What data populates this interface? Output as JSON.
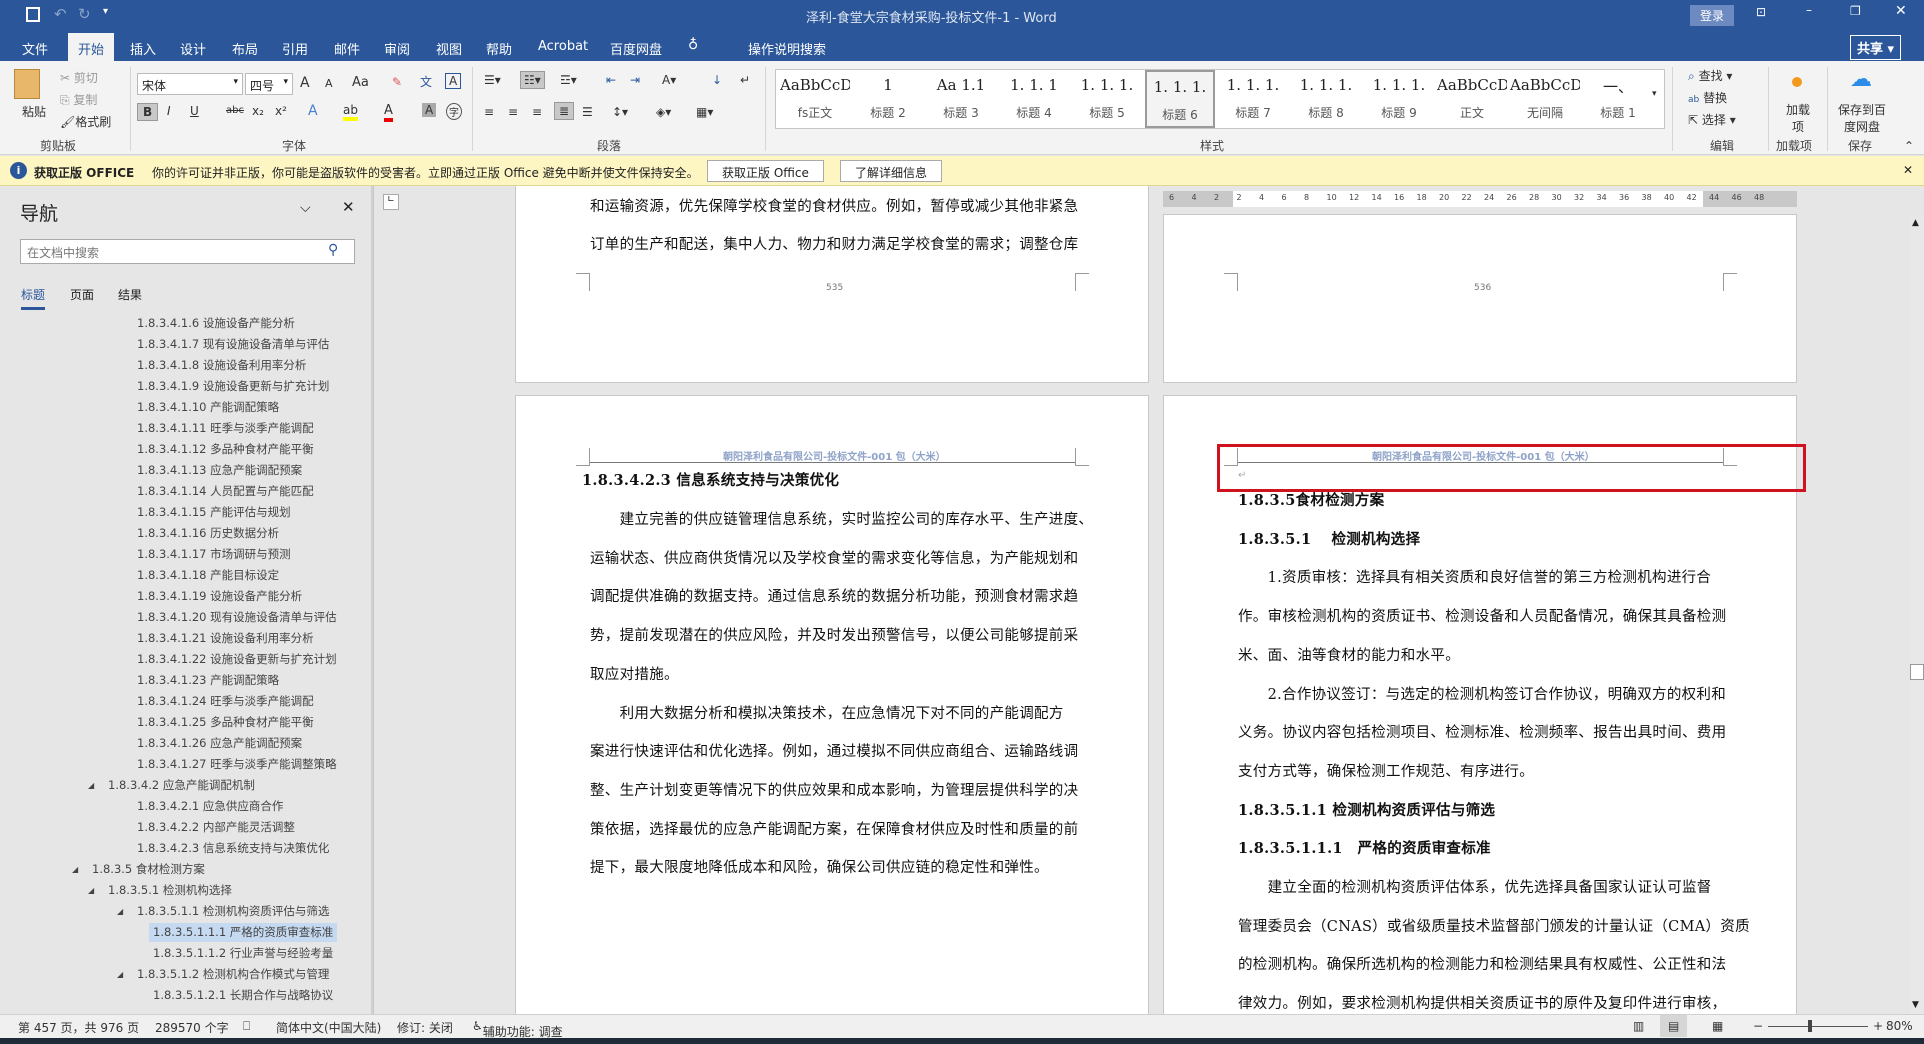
{
  "window": {
    "title": "泽利-食堂大宗食材采购-投标文件-1  -  Word",
    "login": "登录",
    "share": "共享"
  },
  "tabs": [
    "文件",
    "开始",
    "插入",
    "设计",
    "布局",
    "引用",
    "邮件",
    "审阅",
    "视图",
    "帮助",
    "Acrobat",
    "百度网盘"
  ],
  "tell_me": "操作说明搜索",
  "ribbon": {
    "clipboard": {
      "paste": "粘贴",
      "cut": "剪切",
      "copy": "复制",
      "format_painter": "格式刷",
      "label": "剪贴板"
    },
    "font": {
      "name": "宋体",
      "size": "四号",
      "bold": "B",
      "italic": "I",
      "underline": "U",
      "strike": "abc",
      "sub": "x₂",
      "sup": "x²",
      "label": "字体",
      "grow": "A",
      "shrink": "A",
      "case": "Aa"
    },
    "paragraph": {
      "label": "段落"
    },
    "styles": {
      "label": "样式",
      "items": [
        {
          "preview": "AaBbCcDdI",
          "name": "fs正文"
        },
        {
          "preview": "1",
          "name": "标题 2"
        },
        {
          "preview": "Aa 1.1",
          "name": "标题 3"
        },
        {
          "preview": "1. 1. 1",
          "name": "标题 4"
        },
        {
          "preview": "1. 1. 1.",
          "name": "标题 5"
        },
        {
          "preview": "1. 1. 1.",
          "name": "标题 6"
        },
        {
          "preview": "1. 1. 1.",
          "name": "标题 7"
        },
        {
          "preview": "1. 1. 1.",
          "name": "标题 8"
        },
        {
          "preview": "1. 1. 1.",
          "name": "标题 9"
        },
        {
          "preview": "AaBbCcDdI",
          "name": "正文"
        },
        {
          "preview": "AaBbCcDdI",
          "name": "无间隔"
        },
        {
          "preview": "一、",
          "name": "标题 1"
        }
      ]
    },
    "editing": {
      "find": "查找",
      "replace": "替换",
      "select": "选择",
      "label": "编辑"
    },
    "addins": {
      "button": "加载项",
      "label": "加载项"
    },
    "save": {
      "button": "保存到百度网盘",
      "label": "保存"
    }
  },
  "message_bar": {
    "title": "获取正版 OFFICE",
    "text": "你的许可证并非正版，你可能是盗版软件的受害者。立即通过正版 Office 避免中断并使文件保持安全。",
    "btn1": "获取正版 Office",
    "btn2": "了解详细信息"
  },
  "nav": {
    "title": "导航",
    "search_placeholder": "在文档中搜索",
    "tabs": [
      "标题",
      "页面",
      "结果"
    ],
    "items": [
      {
        "t": "1.8.3.4.1.6 设施设备产能分析",
        "l": 3
      },
      {
        "t": "1.8.3.4.1.7 现有设施设备清单与评估",
        "l": 3
      },
      {
        "t": "1.8.3.4.1.8 设施设备利用率分析",
        "l": 3
      },
      {
        "t": "1.8.3.4.1.9 设施设备更新与扩充计划",
        "l": 3
      },
      {
        "t": "1.8.3.4.1.10 产能调配策略",
        "l": 3
      },
      {
        "t": "1.8.3.4.1.11 旺季与淡季产能调配",
        "l": 3
      },
      {
        "t": "1.8.3.4.1.12 多品种食材产能平衡",
        "l": 3
      },
      {
        "t": "1.8.3.4.1.13 应急产能调配预案",
        "l": 3
      },
      {
        "t": "1.8.3.4.1.14 人员配置与产能匹配",
        "l": 3
      },
      {
        "t": "1.8.3.4.1.15 产能评估与规划",
        "l": 3
      },
      {
        "t": "1.8.3.4.1.16 历史数据分析",
        "l": 3
      },
      {
        "t": "1.8.3.4.1.17 市场调研与预测",
        "l": 3
      },
      {
        "t": "1.8.3.4.1.18 产能目标设定",
        "l": 3
      },
      {
        "t": "1.8.3.4.1.19 设施设备产能分析",
        "l": 3
      },
      {
        "t": "1.8.3.4.1.20 现有设施设备清单与评估",
        "l": 3
      },
      {
        "t": "1.8.3.4.1.21 设施设备利用率分析",
        "l": 3
      },
      {
        "t": "1.8.3.4.1.22 设施设备更新与扩充计划",
        "l": 3
      },
      {
        "t": "1.8.3.4.1.23 产能调配策略",
        "l": 3
      },
      {
        "t": "1.8.3.4.1.24 旺季与淡季产能调配",
        "l": 3
      },
      {
        "t": "1.8.3.4.1.25 多品种食材产能平衡",
        "l": 3
      },
      {
        "t": "1.8.3.4.1.26 应急产能调配预案",
        "l": 3
      },
      {
        "t": "1.8.3.4.1.27 旺季与淡季产能调整策略",
        "l": 3
      },
      {
        "t": "1.8.3.4.2 应急产能调配机制",
        "l": 2,
        "e": true
      },
      {
        "t": "1.8.3.4.2.1 应急供应商合作",
        "l": 3
      },
      {
        "t": "1.8.3.4.2.2 内部产能灵活调整",
        "l": 3
      },
      {
        "t": "1.8.3.4.2.3 信息系统支持与决策优化",
        "l": 3
      },
      {
        "t": "1.8.3.5 食材检测方案",
        "l": 1,
        "e": true
      },
      {
        "t": "1.8.3.5.1 检测机构选择",
        "l": 2,
        "e": true
      },
      {
        "t": "1.8.3.5.1.1 检测机构资质评估与筛选",
        "l": 3,
        "e": true
      },
      {
        "t": "1.8.3.5.1.1.1 严格的资质审查标准",
        "l": 4,
        "sel": true
      },
      {
        "t": "1.8.3.5.1.1.2 行业声誉与经验考量",
        "l": 4
      },
      {
        "t": "1.8.3.5.1.2 检测机构合作模式与管理",
        "l": 3,
        "e": true
      },
      {
        "t": "1.8.3.5.1.2.1 长期合作与战略协议",
        "l": 4
      }
    ]
  },
  "ruler": [
    "6",
    "4",
    "2",
    "2",
    "4",
    "6",
    "8",
    "10",
    "12",
    "14",
    "16",
    "18",
    "20",
    "22",
    "24",
    "26",
    "28",
    "30",
    "32",
    "34",
    "36",
    "38",
    "40",
    "42",
    "44",
    "46",
    "48"
  ],
  "pages": {
    "left_top": {
      "lines": [
        "和运输资源，优先保障学校食堂的食材供应。例如，暂停或减少其他非紧急",
        "订单的生产和配送，集中人力、物力和财力满足学校食堂的需求；调整仓库"
      ],
      "page_no": "535"
    },
    "right_top": {
      "page_no": "536"
    },
    "header": "朝阳泽利食品有限公司-投标文件-001 包（大米）",
    "left": {
      "heading": "1.8.3.4.2.3 信息系统支持与决策优化",
      "lines": [
        "　　建立完善的供应链管理信息系统，实时监控公司的库存水平、生产进度、",
        "运输状态、供应商供货情况以及学校食堂的需求变化等信息，为产能规划和",
        "调配提供准确的数据支持。通过信息系统的数据分析功能，预测食材需求趋",
        "势，提前发现潜在的供应风险，并及时发出预警信号，以便公司能够提前采",
        "取应对措施。",
        "　　利用大数据分析和模拟决策技术，在应急情况下对不同的产能调配方",
        "案进行快速评估和优化选择。例如，通过模拟不同供应商组合、运输路线调",
        "整、生产计划变更等情况下的供应效果和成本影响，为管理层提供科学的决",
        "策依据，选择最优的应急产能调配方案，在保障食材供应及时性和质量的前",
        "提下，最大限度地降低成本和风险，确保公司供应链的稳定性和弹性。"
      ]
    },
    "right": {
      "lines": [
        {
          "t": "1.8.3.5食材检测方案",
          "h": true
        },
        {
          "t": "1.8.3.5.1　 检测机构选择",
          "h": true
        },
        {
          "t": "　　1.资质审核：选择具有相关资质和良好信誉的第三方检测机构进行合"
        },
        {
          "t": "作。审核检测机构的资质证书、检测设备和人员配备情况，确保其具备检测"
        },
        {
          "t": "米、面、油等食材的能力和水平。"
        },
        {
          "t": "　　2.合作协议签订：与选定的检测机构签订合作协议，明确双方的权利和"
        },
        {
          "t": "义务。协议内容包括检测项目、检测标准、检测频率、报告出具时间、费用"
        },
        {
          "t": "支付方式等，确保检测工作规范、有序进行。"
        },
        {
          "t": "1.8.3.5.1.1 检测机构资质评估与筛选",
          "h": true
        },
        {
          "t": "1.8.3.5.1.1.1　严格的资质审查标准",
          "h": true
        },
        {
          "t": "　　建立全面的检测机构资质评估体系，优先选择具备国家认证认可监督"
        },
        {
          "t": "管理委员会（CNAS）或省级质量技术监督部门颁发的计量认证（CMA）资质"
        },
        {
          "t": "的检测机构。确保所选机构的检测能力和检测结果具有权威性、公正性和法"
        },
        {
          "t": "律效力。例如，要求检测机构提供相关资质证书的原件及复印件进行审核，"
        }
      ]
    }
  },
  "status": {
    "page": "第 457 页，共 976 页",
    "words": "289570 个字",
    "lang": "简体中文(中国大陆)",
    "track": "修订: 关闭",
    "access": "辅助功能: 调查",
    "zoom": "80%",
    "zoom_fraction": 0.4
  },
  "colors": {
    "accent": "#2b579a",
    "highlight_box": "#d0121f"
  }
}
